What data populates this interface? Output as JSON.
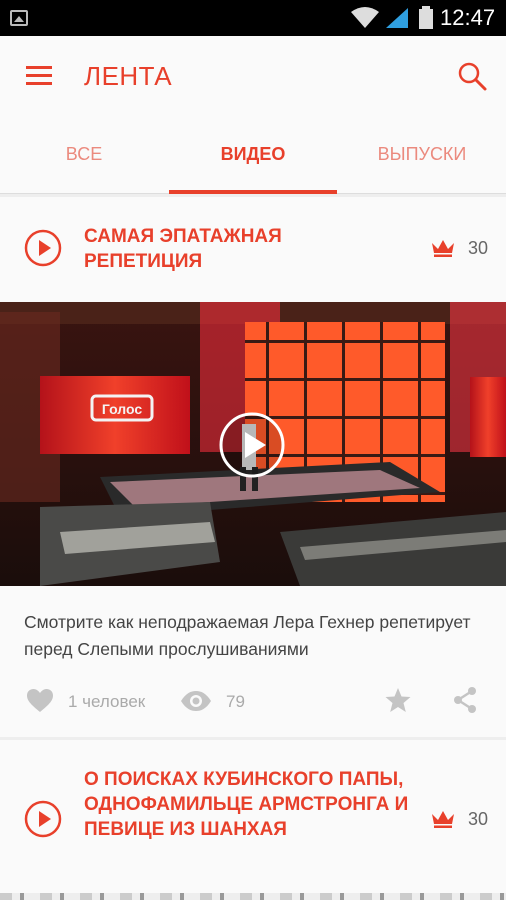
{
  "status_bar": {
    "time": "12:47",
    "icons": [
      "image-notification-icon",
      "wifi-icon",
      "signal-icon",
      "battery-icon"
    ]
  },
  "app_bar": {
    "title": "ЛЕНТА",
    "menu_icon": "hamburger-menu-icon",
    "search_icon": "search-icon"
  },
  "tabs": [
    {
      "label": "ВСЕ",
      "active": false
    },
    {
      "label": "ВИДЕО",
      "active": true
    },
    {
      "label": "ВЫПУСКИ",
      "active": false
    }
  ],
  "colors": {
    "accent": "#e8402b",
    "accent_light": "#eb8a7e",
    "text": "#444444",
    "muted": "#aaaaaa"
  },
  "posts": [
    {
      "title": "САМАЯ ЭПАТАЖНАЯ РЕПЕТИЦИЯ",
      "rating": "30",
      "description": "Смотрите как неподражаемая Лера Гехнер репетирует перед Слепыми прослушиваниями",
      "likes": "1 человек",
      "views": "79",
      "thumbnail_sign": "Голос"
    },
    {
      "title": "О ПОИСКАХ КУБИНСКОГО ПАПЫ, ОДНОФАМИЛЬЦЕ АРМСТРОНГА И ПЕВИЦЕ ИЗ ШАНХАЯ",
      "rating": "30"
    }
  ]
}
